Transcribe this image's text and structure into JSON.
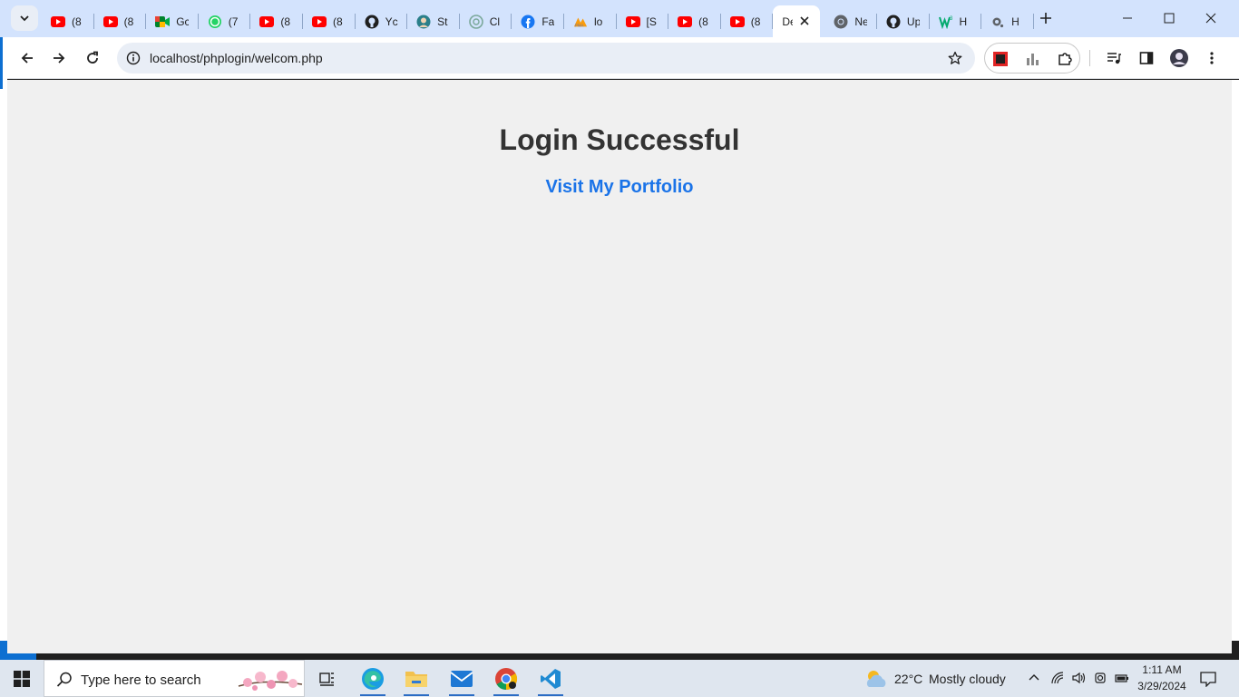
{
  "browser": {
    "tabs": [
      {
        "title": "(8",
        "icon": "youtube-icon"
      },
      {
        "title": "(8",
        "icon": "youtube-icon"
      },
      {
        "title": "Gc",
        "icon": "google-meet-icon"
      },
      {
        "title": "(7",
        "icon": "whatsapp-icon"
      },
      {
        "title": "(8",
        "icon": "youtube-icon"
      },
      {
        "title": "(8",
        "icon": "youtube-icon"
      },
      {
        "title": "Yc",
        "icon": "github-icon"
      },
      {
        "title": "St",
        "icon": "user-avatar-icon"
      },
      {
        "title": "Cl",
        "icon": "chatgpt-icon"
      },
      {
        "title": "Fa",
        "icon": "facebook-icon"
      },
      {
        "title": "lo",
        "icon": "phpmyadmin-icon"
      },
      {
        "title": "[S",
        "icon": "youtube-icon"
      },
      {
        "title": "(8",
        "icon": "youtube-icon"
      },
      {
        "title": "(8",
        "icon": "youtube-icon"
      },
      {
        "title": "De",
        "icon": "none",
        "active": true
      },
      {
        "title": "Ne",
        "icon": "chrome-icon"
      },
      {
        "title": "Up",
        "icon": "github-icon"
      },
      {
        "title": "H",
        "icon": "w3schools-icon"
      },
      {
        "title": "H",
        "icon": "generic-page-icon"
      }
    ],
    "url": "localhost/phplogin/welcom.php",
    "colors": {
      "tabstrip": "#d3e3fd",
      "toolbar": "#ffffff",
      "omnibox": "#e9eef6"
    }
  },
  "page": {
    "title": "Login Successful",
    "link_label": "Visit My Portfolio",
    "colors": {
      "background": "#f0f0f0",
      "title": "#333333",
      "link": "#1a73e8"
    }
  },
  "taskbar": {
    "search_placeholder": "Type here to search",
    "apps": [
      "task-view",
      "microsoft-edge",
      "file-explorer",
      "mail",
      "google-chrome",
      "visual-studio-code"
    ],
    "weather": {
      "temp": "22°C",
      "desc": "Mostly cloudy"
    },
    "clock": {
      "time": "1:11 AM",
      "date": "3/29/2024"
    }
  }
}
